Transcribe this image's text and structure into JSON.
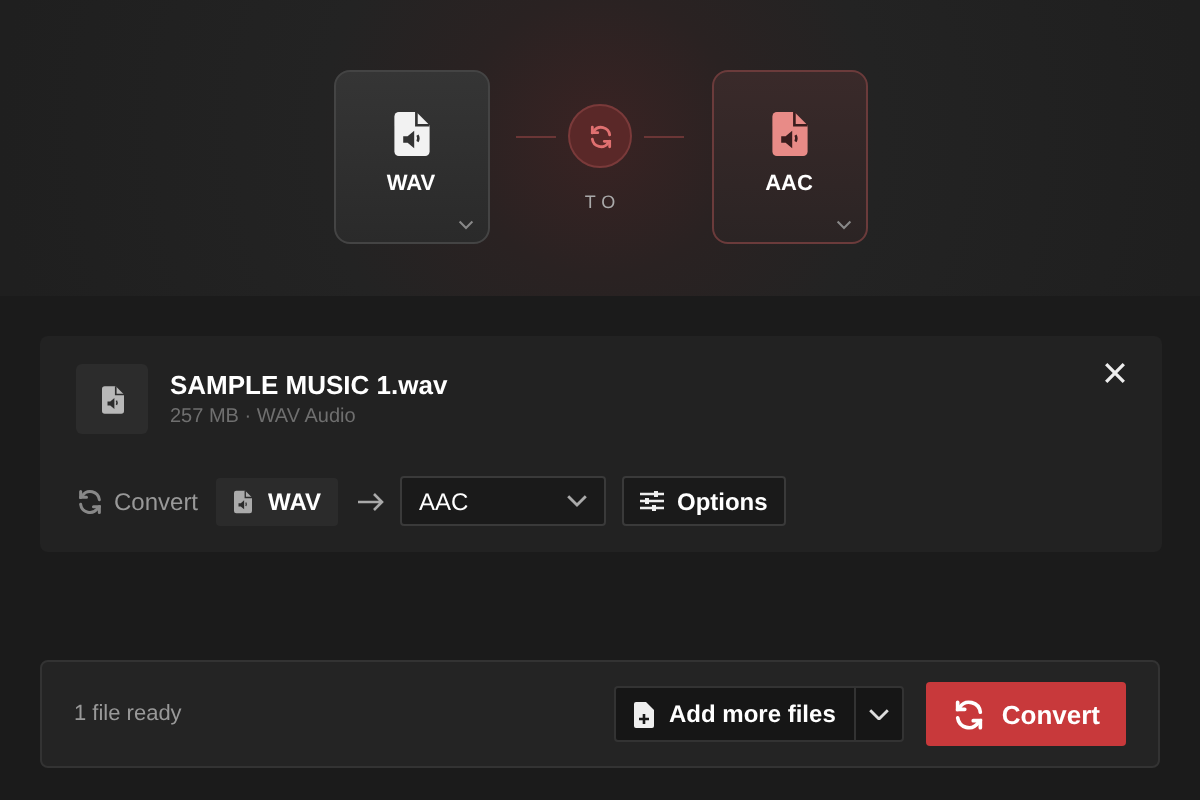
{
  "converter": {
    "source": {
      "format": "WAV"
    },
    "connector": "TO",
    "target": {
      "format": "AAC"
    }
  },
  "file": {
    "name": "SAMPLE MUSIC 1.wav",
    "meta": "257 MB · WAV Audio",
    "convert_label": "Convert",
    "from_format": "WAV",
    "target_format": "AAC",
    "options_label": "Options"
  },
  "footer": {
    "status": "1 file ready",
    "add_button": "Add more files",
    "convert_button": "Convert"
  }
}
